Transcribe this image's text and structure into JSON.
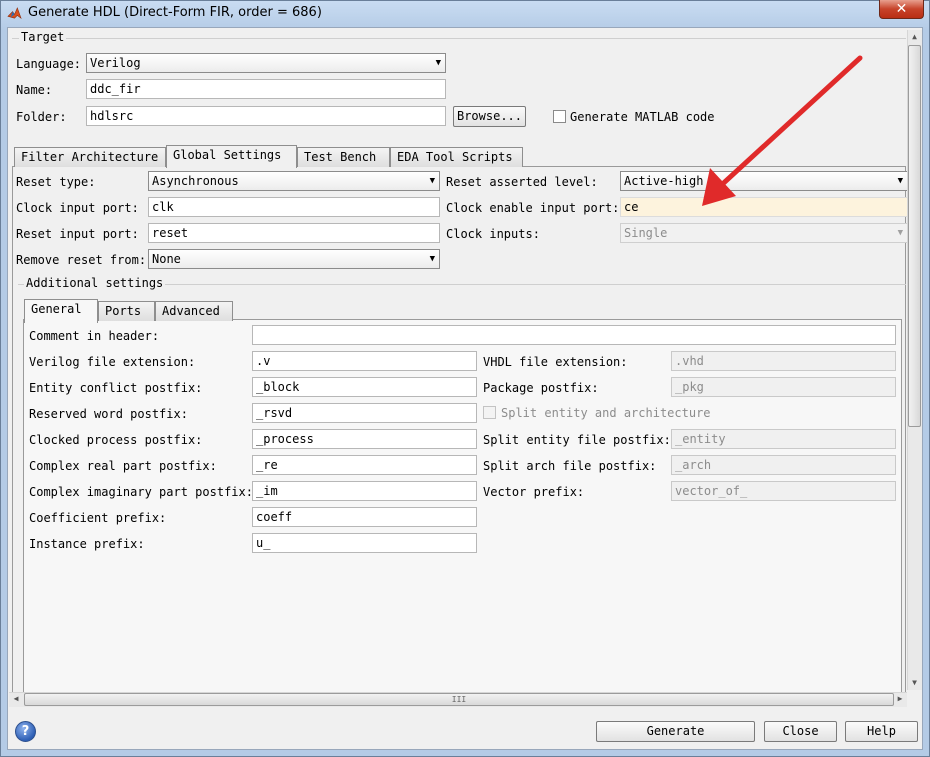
{
  "window": {
    "title": "Generate HDL (Direct-Form FIR, order = 686)",
    "close_glyph": "✕",
    "minimize_glyph": "—",
    "maximize_glyph": "▭"
  },
  "target": {
    "group_label": "Target",
    "language_label": "Language:",
    "language_value": "Verilog",
    "name_label": "Name:",
    "name_value": "ddc_fir",
    "folder_label": "Folder:",
    "folder_value": "hdlsrc",
    "browse_label": "Browse...",
    "generate_matlab_label": "Generate MATLAB code"
  },
  "tabs": [
    {
      "label": "Filter Architecture"
    },
    {
      "label": "Global Settings"
    },
    {
      "label": "Test Bench"
    },
    {
      "label": "EDA Tool Scripts"
    }
  ],
  "global": {
    "reset_type_label": "Reset type:",
    "reset_type_value": "Asynchronous",
    "reset_asserted_label": "Reset asserted level:",
    "reset_asserted_value": "Active-high",
    "clock_input_label": "Clock input port:",
    "clock_input_value": "clk",
    "clock_enable_label": "Clock enable input port:",
    "clock_enable_value": "ce",
    "reset_input_label": "Reset input port:",
    "reset_input_value": "reset",
    "clock_inputs_label": "Clock inputs:",
    "clock_inputs_value": "Single",
    "remove_reset_label": "Remove reset from:",
    "remove_reset_value": "None",
    "additional_label": "Additional settings"
  },
  "subtabs": [
    {
      "label": "General"
    },
    {
      "label": "Ports"
    },
    {
      "label": "Advanced"
    }
  ],
  "general": {
    "comment_label": "Comment in header:",
    "comment_value": "",
    "verilog_ext_label": "Verilog file extension:",
    "verilog_ext_value": ".v",
    "vhdl_ext_label": "VHDL file extension:",
    "vhdl_ext_value": ".vhd",
    "entity_conflict_label": "Entity conflict postfix:",
    "entity_conflict_value": "_block",
    "package_postfix_label": "Package postfix:",
    "package_postfix_value": "_pkg",
    "reserved_label": "Reserved word postfix:",
    "reserved_value": "_rsvd",
    "split_entity_arch_label": "Split entity and architecture",
    "clocked_label": "Clocked process postfix:",
    "clocked_value": "_process",
    "split_entity_file_label": "Split entity file postfix:",
    "split_entity_file_value": "_entity",
    "complex_real_label": "Complex real part postfix:",
    "complex_real_value": "_re",
    "split_arch_label": "Split arch file postfix:",
    "split_arch_value": "_arch",
    "complex_imag_label": "Complex imaginary part postfix:",
    "complex_imag_value": "_im",
    "vector_prefix_label": "Vector prefix:",
    "vector_prefix_value": "vector_of_",
    "coeff_prefix_label": "Coefficient prefix:",
    "coeff_prefix_value": "coeff",
    "instance_prefix_label": "Instance prefix:",
    "instance_prefix_value": "u_"
  },
  "scroll": {
    "hscroll_grip": "III",
    "up": "▲",
    "down": "▼",
    "left": "◀",
    "right": "▶"
  },
  "footer": {
    "help_icon_glyph": "?",
    "generate_label": "Generate",
    "close_label": "Close",
    "help_label": "Help"
  },
  "colors": {
    "annotation_arrow": "#e02a2a",
    "highlight_field": "#fdf3dd"
  }
}
